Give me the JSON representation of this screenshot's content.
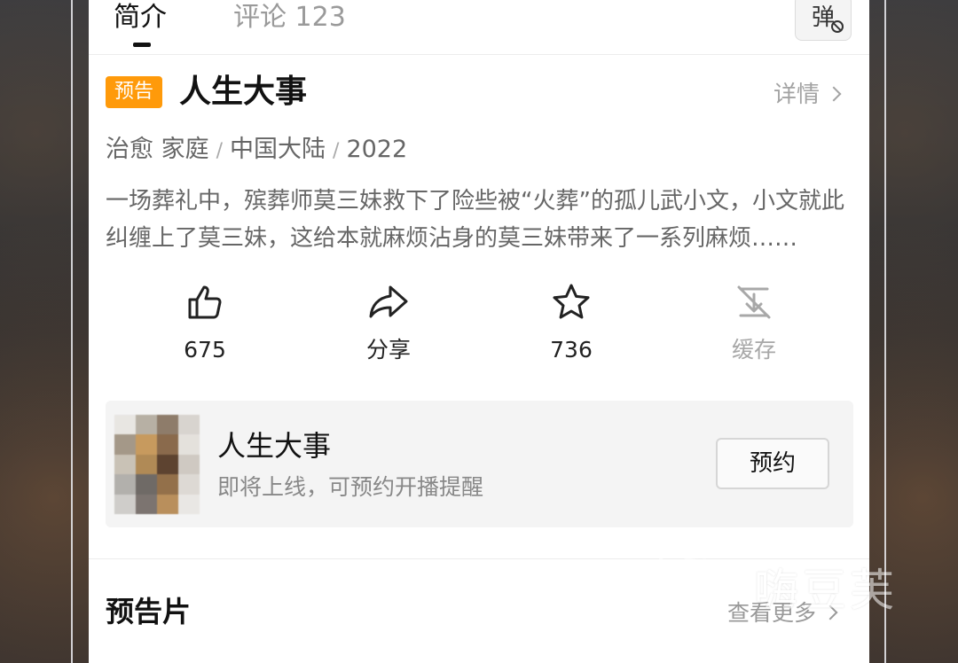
{
  "tabs": {
    "intro_label": "简介",
    "comments_label": "评论 123",
    "danmaku_label": "弹"
  },
  "movie": {
    "badge": "预告",
    "title": "人生大事",
    "details_link": "详情",
    "genres": "治愈 家庭",
    "region": "中国大陆",
    "year": "2022",
    "synopsis": "一场葬礼中，殡葬师莫三妹救下了险些被“火葬”的孤儿武小文，小文就此纠缠上了莫三妹，这给本就麻烦沾身的莫三妹带来了一系列麻烦……"
  },
  "actions": {
    "like_count": "675",
    "share_label": "分享",
    "favorite_count": "736",
    "cache_label": "缓存"
  },
  "reservation": {
    "title": "人生大事",
    "subtitle": "即将上线，可预约开播提醒",
    "button_label": "预约"
  },
  "trailers": {
    "section_title": "预告片",
    "see_more_label": "查看更多"
  },
  "watermark": {
    "text": "嗨豆芙"
  },
  "colors": {
    "badge": "#ff9a0a",
    "text_primary": "#111111",
    "text_secondary": "#666666",
    "muted": "#a3a3a3"
  }
}
